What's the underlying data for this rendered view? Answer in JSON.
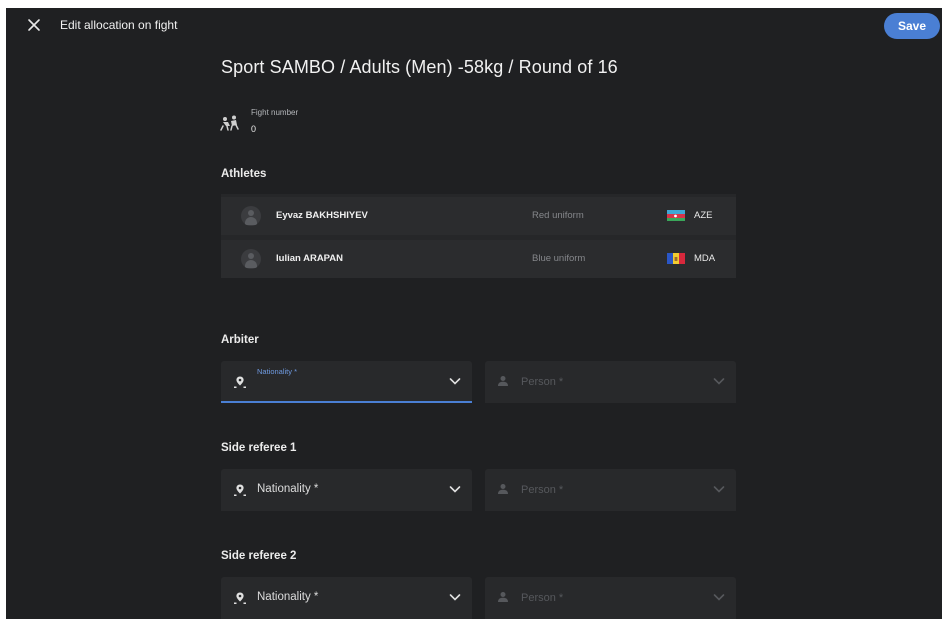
{
  "topbar": {
    "title": "Edit allocation on fight",
    "save_label": "Save"
  },
  "heading": "Sport SAMBO / Adults (Men) -58kg / Round of 16",
  "fight": {
    "caption": "Fight number",
    "value": "0"
  },
  "athletes": {
    "title": "Athletes",
    "rows": [
      {
        "name": "Eyvaz BAKHSHIYEV",
        "uniform": "Red uniform",
        "country": "AZE",
        "flag": "azerbaijan-flag"
      },
      {
        "name": "Iulian ARAPAN",
        "uniform": "Blue uniform",
        "country": "MDA",
        "flag": "moldova-flag"
      }
    ]
  },
  "officials": [
    {
      "title": "Arbiter",
      "nationality_label": "Nationality *",
      "person_label": "Person *",
      "focused": true
    },
    {
      "title": "Side referee 1",
      "nationality_label": "Nationality *",
      "person_label": "Person *",
      "focused": false
    },
    {
      "title": "Side referee 2",
      "nationality_label": "Nationality *",
      "person_label": "Person *",
      "focused": false
    }
  ],
  "colors": {
    "background": "#1f2022",
    "accent": "#4a7fd4",
    "row": "#2b2c2e",
    "field": "#28292b"
  }
}
